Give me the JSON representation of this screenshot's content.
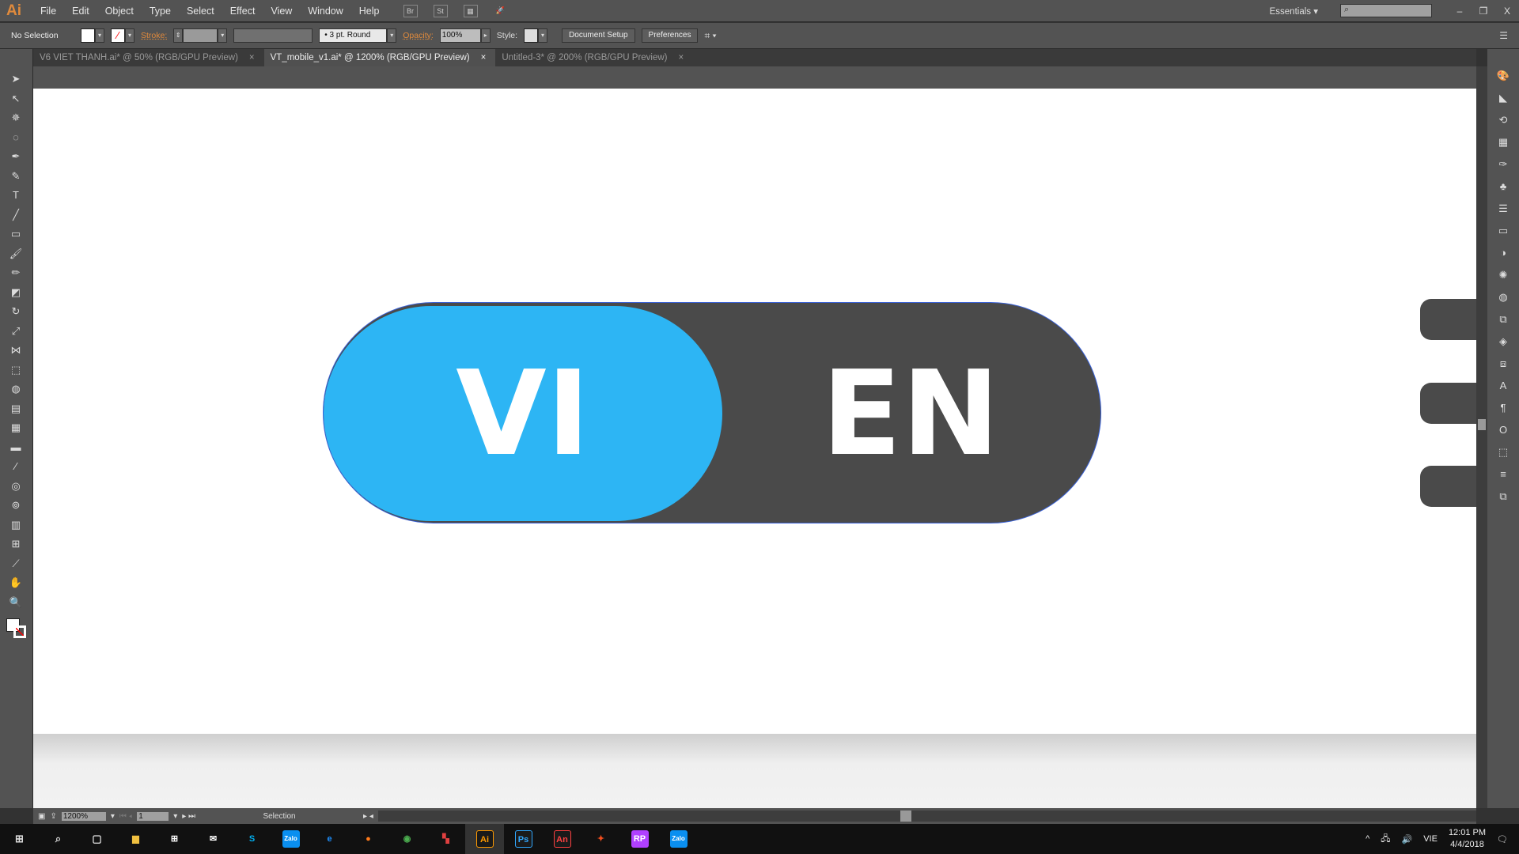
{
  "app": {
    "logo": "Ai",
    "menus": [
      "File",
      "Edit",
      "Object",
      "Type",
      "Select",
      "Effect",
      "View",
      "Window",
      "Help"
    ],
    "bridge": "Br",
    "stock": "St",
    "workspace": "Essentials",
    "search_placeholder": ""
  },
  "control": {
    "selection": "No Selection",
    "stroke_label": "Stroke:",
    "brush": "3 pt. Round",
    "opacity_label": "Opacity:",
    "opacity": "100%",
    "style_label": "Style:",
    "document_setup": "Document Setup",
    "preferences": "Preferences"
  },
  "tabs": [
    {
      "label": "V6 VIET THANH.ai* @ 50% (RGB/GPU Preview)",
      "active": false
    },
    {
      "label": "VT_mobile_v1.ai* @ 1200% (RGB/GPU Preview)",
      "active": true
    },
    {
      "label": "Untitled-3* @ 200% (RGB/GPU Preview)",
      "active": false
    }
  ],
  "close_glyph": "×",
  "artwork": {
    "left_label": "VI",
    "right_label": "EN",
    "active_color": "#2db5f4",
    "track_color": "#4a4a4a"
  },
  "status": {
    "zoom": "1200%",
    "artboard": "1",
    "tool": "Selection"
  },
  "taskbar": {
    "time": "12:01 PM",
    "date": "4/4/2018",
    "lang": "VIE",
    "apps": [
      {
        "name": "file-explorer",
        "t": "▆",
        "c": "#f0c040"
      },
      {
        "name": "store",
        "t": "⊞",
        "c": "#fff"
      },
      {
        "name": "mail",
        "t": "✉",
        "c": "#fff"
      },
      {
        "name": "skype",
        "t": "S",
        "c": "#00aff0"
      },
      {
        "name": "zalo",
        "t": "Zalo",
        "c": "#0a8ff0"
      },
      {
        "name": "edge",
        "t": "e",
        "c": "#1e90ff"
      },
      {
        "name": "firefox",
        "t": "●",
        "c": "#ff7a1a"
      },
      {
        "name": "chrome",
        "t": "◉",
        "c": "#4caf50"
      },
      {
        "name": "app",
        "t": "▚",
        "c": "#e04040"
      },
      {
        "name": "illustrator",
        "t": "Ai",
        "c": "#ff9a00"
      },
      {
        "name": "photoshop",
        "t": "Ps",
        "c": "#31a8ff"
      },
      {
        "name": "animate",
        "t": "An",
        "c": "#ff4040"
      },
      {
        "name": "figma",
        "t": "✦",
        "c": "#f24e1e"
      },
      {
        "name": "axure-rp",
        "t": "RP",
        "c": "#b040ff"
      },
      {
        "name": "zalo-2",
        "t": "Zalo",
        "c": "#0a8ff0"
      }
    ]
  }
}
